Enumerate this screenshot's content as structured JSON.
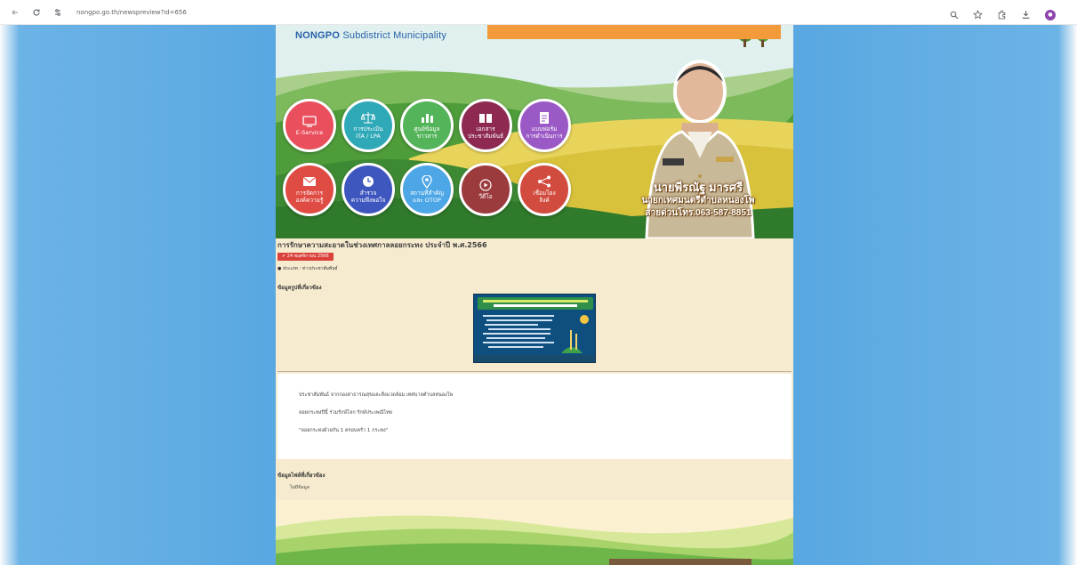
{
  "browser": {
    "url": "nongpo.go.th/newspreview?id=656"
  },
  "banner": {
    "brand_bold": "NONGPO",
    "brand_rest": " Subdistrict Municipality",
    "circles": [
      {
        "label": "E-Service",
        "icon": "monitor-icon",
        "color": "#e94f5c"
      },
      {
        "label": "การประเมิน\nITA / LPA",
        "icon": "scale-icon",
        "color": "#2fa9b8"
      },
      {
        "label": "ศูนย์ข้อมูล\nข่าวสาร",
        "icon": "bar-chart-icon",
        "color": "#53b45a"
      },
      {
        "label": "เอกสาร\nประชาสัมพันธ์",
        "icon": "book-icon",
        "color": "#8e2a52"
      },
      {
        "label": "แบบฟอร์ม\nการดำเนินการ",
        "icon": "document-icon",
        "color": "#9b59c6"
      },
      {
        "label": "การจัดการ\nองค์ความรู้",
        "icon": "mail-icon",
        "color": "#df4c44"
      },
      {
        "label": "สำรวจ\nความพึงพอใจ",
        "icon": "clock-icon",
        "color": "#3e57bf"
      },
      {
        "label": "สถานที่สำคัญ\nและ OTOP",
        "icon": "location-pin-icon",
        "color": "#4da6e6"
      },
      {
        "label": "วีดีโอ",
        "icon": "play-icon",
        "color": "#9c3b3e"
      },
      {
        "label": "เชื่อมโยง\nลิงค์",
        "icon": "share-icon",
        "color": "#d14b3f"
      }
    ],
    "mayor_name": "นายพีรณัฐ มารศรี",
    "mayor_title": "นายกเทศมนตรีตำบลหนองโพ",
    "hotline": "สายด่วนโทร.063-587-8851"
  },
  "news": {
    "title": "การรักษาความสะอาดในช่วงเทศกาลลอยกระทง ประจำปี พ.ศ.2566",
    "date": "✔ 24 พฤศจิกายน 2566",
    "category": "ประเภท : ข่าวประชาสัมพันธ์",
    "related_heading": "ข้อมูลรูปที่เกี่ยวข้อง",
    "body_lines": [
      "ประชาสัมพันธ์ จากกองสาธารณสุขและสิ่งแวดล้อม เทศบาลตำบลหนองโพ",
      "ลอยกระทงปีนี้ ร่วมรักษ์โลก รักษ์ประเพณีไทย",
      "\"ลอยกระทงด้วยกัน 1 ครอบครัว 1 กระทง\""
    ],
    "files_heading": "ข้อมูลไฟล์ที่เกี่ยวข้อง",
    "files_empty": "ไม่มีข้อมูล"
  },
  "colors": {
    "page_bg": "#5aa8e1",
    "content_bg": "#f7ebcf",
    "badge": "#d9413a"
  }
}
